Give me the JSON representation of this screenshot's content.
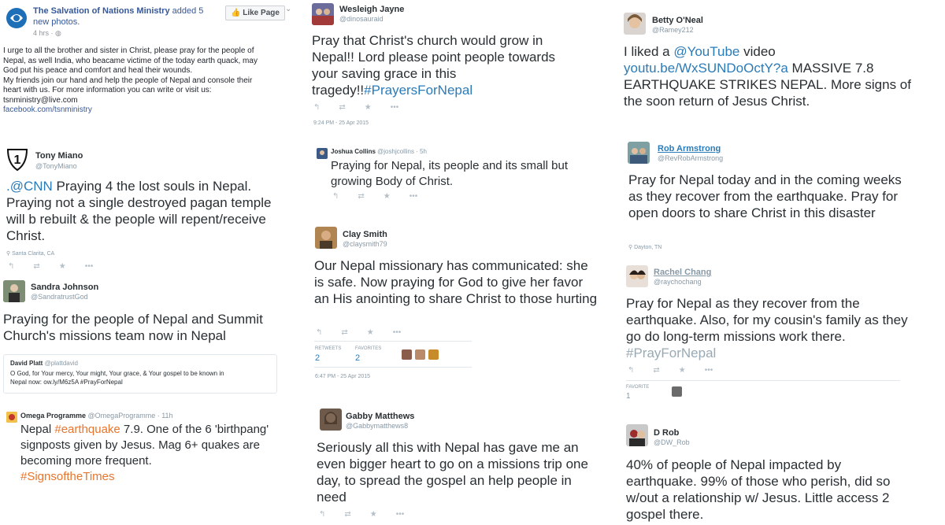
{
  "fb": {
    "page_name": "The Salvation of Nations Ministry",
    "added": " added 5 new photos.",
    "time": "4 hrs · ",
    "like_button": "Like Page",
    "body_lines": [
      "I urge to all the brother and sister in Christ, please pray for the people of",
      "Nepal, as well India, who beacame victime of the today earth quack, may",
      "God put his peace and comfort and heal their wounds.",
      "My friends join our hand and help the people of Nepal and console their",
      "heart with us. For more information you can write or visit us:",
      "tsnministry@live.com"
    ],
    "link": "facebook.com/tsnministry"
  },
  "tweets": {
    "tony": {
      "name": "Tony Miano",
      "handle": "@TonyMiano",
      "mention": ".@CNN",
      "text": " Praying 4 the lost souls in Nepal. Praying not a single destroyed pagan temple will b rebuilt & the people will repent/receive Christ.",
      "location": "Santa Clarita, CA"
    },
    "sandra": {
      "name": "Sandra Johnson",
      "handle": "@SandratrustGod",
      "text": "Praying for the people of Nepal and Summit Church's missions team now in Nepal",
      "quote_name": "David Platt",
      "quote_handle": "@plattdavid",
      "quote_text": "O God, for Your mercy, Your might, Your grace, & Your gospel to be known in Nepal now: ow.ly/M6z5A #PrayForNepal"
    },
    "omega": {
      "name": "Omega Programme",
      "handle": "@OmegaProgramme · 11h",
      "pre": "Nepal ",
      "tag1": "#earthquake",
      "text": " 7.9. One of the 6 'birthpang' signposts given by Jesus. Mag 6+ quakes are becoming more frequent.",
      "tag2": "#SignsoftheTimes"
    },
    "wesleigh": {
      "name": "Wesleigh Jayne",
      "handle": "@dinosauraid",
      "text": "Pray that Christ's church would grow in Nepal!! Lord please point people towards your saving grace in this tragedy!!",
      "tag": "#PrayersForNepal",
      "timestamp": "9:24 PM - 25 Apr 2015"
    },
    "joshua": {
      "name": "Joshua Collins",
      "handle": "@joshjcollins · 5h",
      "text": "Praying for Nepal, its people and its small but growing Body of Christ."
    },
    "clay": {
      "name": "Clay Smith",
      "handle": "@claysmith79",
      "text": "Our Nepal missionary has communicated: she is safe. Now praying for God to give her favor an His anointing to share Christ to those hurting",
      "retweets_label": "RETWEETS",
      "retweets": "2",
      "favorites_label": "FAVORITES",
      "favorites": "2",
      "timestamp": "6:47 PM - 25 Apr 2015"
    },
    "gabby": {
      "name": "Gabby Matthews",
      "handle": "@Gabbymatthews8",
      "text": "Seriously all this with Nepal has gave me an even bigger heart to go on a missions trip one day, to spread the gospel an help people in need"
    },
    "betty": {
      "name": "Betty O'Neal",
      "handle": "@Ramey212",
      "pre": "I liked a ",
      "mention": "@YouTube",
      "mid": " video ",
      "link": "youtu.be/WxSUNDoOctY?a",
      "text": " MASSIVE 7.8 EARTHQUAKE STRIKES NEPAL. More signs of the soon return of Jesus Christ."
    },
    "rob": {
      "name": "Rob Armstrong",
      "handle": "@RevRobArmstrong",
      "text": "Pray for Nepal today and in the coming weeks as they recover from the earthquake. Pray for open doors to share Christ in this disaster",
      "location": "Dayton, TN"
    },
    "rachel": {
      "name": "Rachel Chang",
      "handle": "@raychochang",
      "text": "Pray for Nepal as they recover from the earthquake. Also, for my cousin's family as they go do long-term missions work there.",
      "tag": "#PrayForNepal",
      "favorite_label": "FAVORITE",
      "favorites": "1"
    },
    "drob": {
      "name": "D Rob",
      "handle": "@DW_Rob",
      "text": "40% of people of Nepal impacted by earthquake.  99% of those who perish, did so w/out a relationship w/ Jesus. Little access 2 gospel there."
    }
  },
  "icons": {
    "reply": "reply-icon",
    "retweet": "retweet-icon",
    "favorite": "star-icon",
    "more": "more-icon"
  },
  "colors": {
    "link": "#2b7bb9",
    "orange_tag": "#e8752d",
    "muted": "#8899a6",
    "fb_blue": "#365899"
  }
}
